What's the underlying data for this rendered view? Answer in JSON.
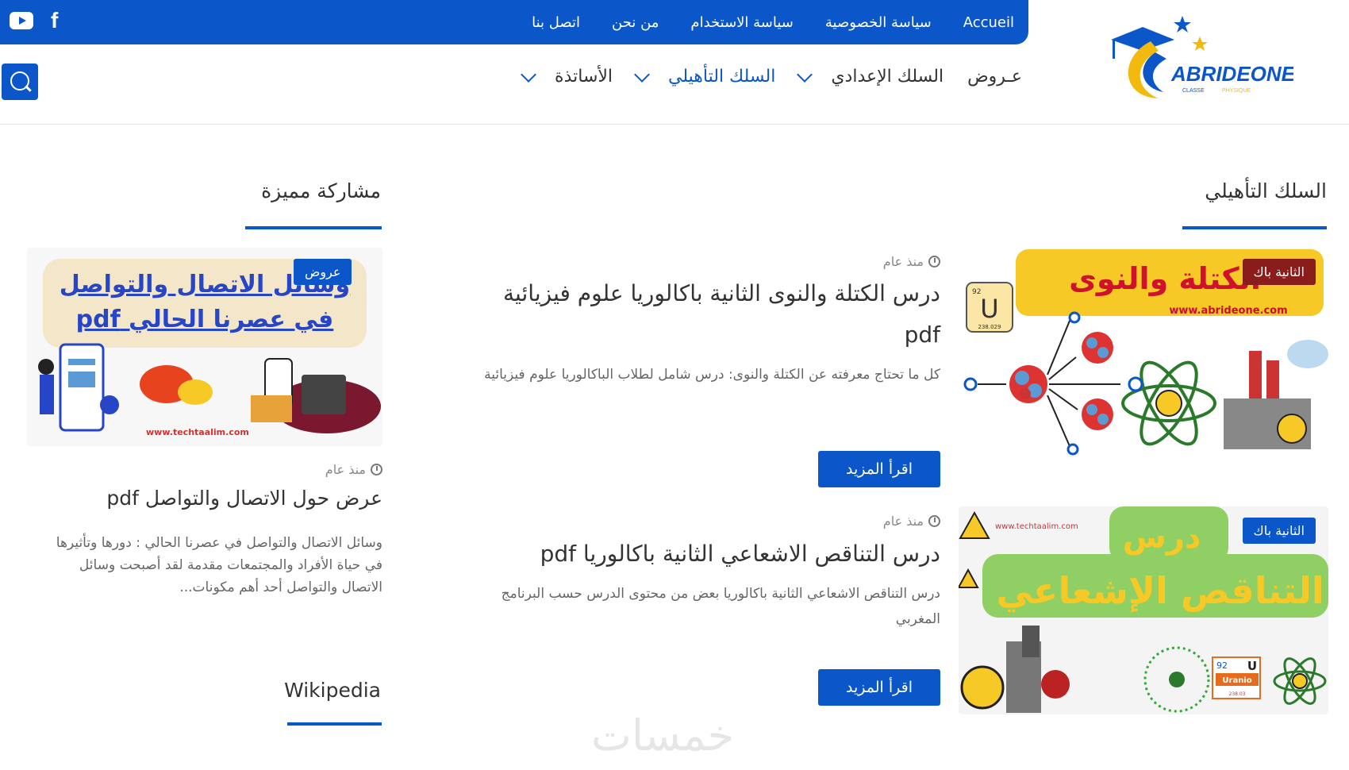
{
  "topbar": {
    "links": [
      "Accueil",
      "سياسة الخصوصية",
      "سياسة الاستخدام",
      "من نحن",
      "اتصل بنا"
    ]
  },
  "logo": {
    "name": "ABRIDEONE",
    "tagline_left": "CLASSE",
    "tagline_right": "PHYSIQUE"
  },
  "nav": {
    "items": [
      {
        "label": "عـروض",
        "has_dropdown": false
      },
      {
        "label": "السلك الإعدادي",
        "has_dropdown": true
      },
      {
        "label": "السلك التأهيلي",
        "has_dropdown": true,
        "active": true
      },
      {
        "label": "الأساتذة",
        "has_dropdown": true
      }
    ]
  },
  "sections": {
    "main_title": "السلك التأهيلي",
    "featured_title": "مشاركة مميزة",
    "wikipedia_title": "Wikipedia"
  },
  "posts": [
    {
      "badge": "الثانية باك",
      "time": "منذ عام",
      "title": "درس الكتلة والنوى الثانية باكالوريا علوم فيزيائية pdf",
      "excerpt": "كل ما تحتاج معرفته عن الكتلة والنوى: درس شامل لطلاب الباكالوريا علوم فيزيائية",
      "read_more": "اقرأ المزيد",
      "thumb_text": "الكتلة والنوى",
      "thumb_url": "www.abrideone.com",
      "element_number": "92",
      "element_symbol": "U",
      "element_mass": "238.029"
    },
    {
      "badge": "الثانية باك",
      "time": "منذ عام",
      "title": "درس التناقص الاشعاعي الثانية باكالوريا pdf",
      "excerpt": "درس التناقص الاشعاعي الثانية باكالوريا  بعض من محتوى الدرس حسب البرنامج المغربي",
      "read_more": "اقرأ المزيد",
      "thumb_line1": "درس",
      "thumb_line2": "التناقص الإشعاعي",
      "thumb_url": "www.techtaalim.com",
      "element_number": "92",
      "element_symbol": "U",
      "element_name": "Uranio",
      "element_mass": "238.03"
    }
  ],
  "featured": {
    "badge": "عروض",
    "time": "منذ عام",
    "title": "عرض حول الاتصال والتواصل pdf",
    "excerpt": "وسائل الاتصال والتواصل في عصرنا الحالي : دورها وتأثيرها في حياة الأفراد والمجتمعات  مقدمة لقد أصبحت وسائل الاتصال والتواصل أحد أهم مكونات...",
    "thumb_line1": "وسائل الاتصال والتواصل",
    "thumb_line2": "في عصرنا الحالي pdf",
    "thumb_url": "www.techtaalim.com"
  },
  "watermark": "خمسات",
  "colors": {
    "primary": "#0b57c9",
    "badge_dark": "#8a1c1c",
    "accent_green": "#8fcf63",
    "accent_yellow": "#f6c927"
  }
}
